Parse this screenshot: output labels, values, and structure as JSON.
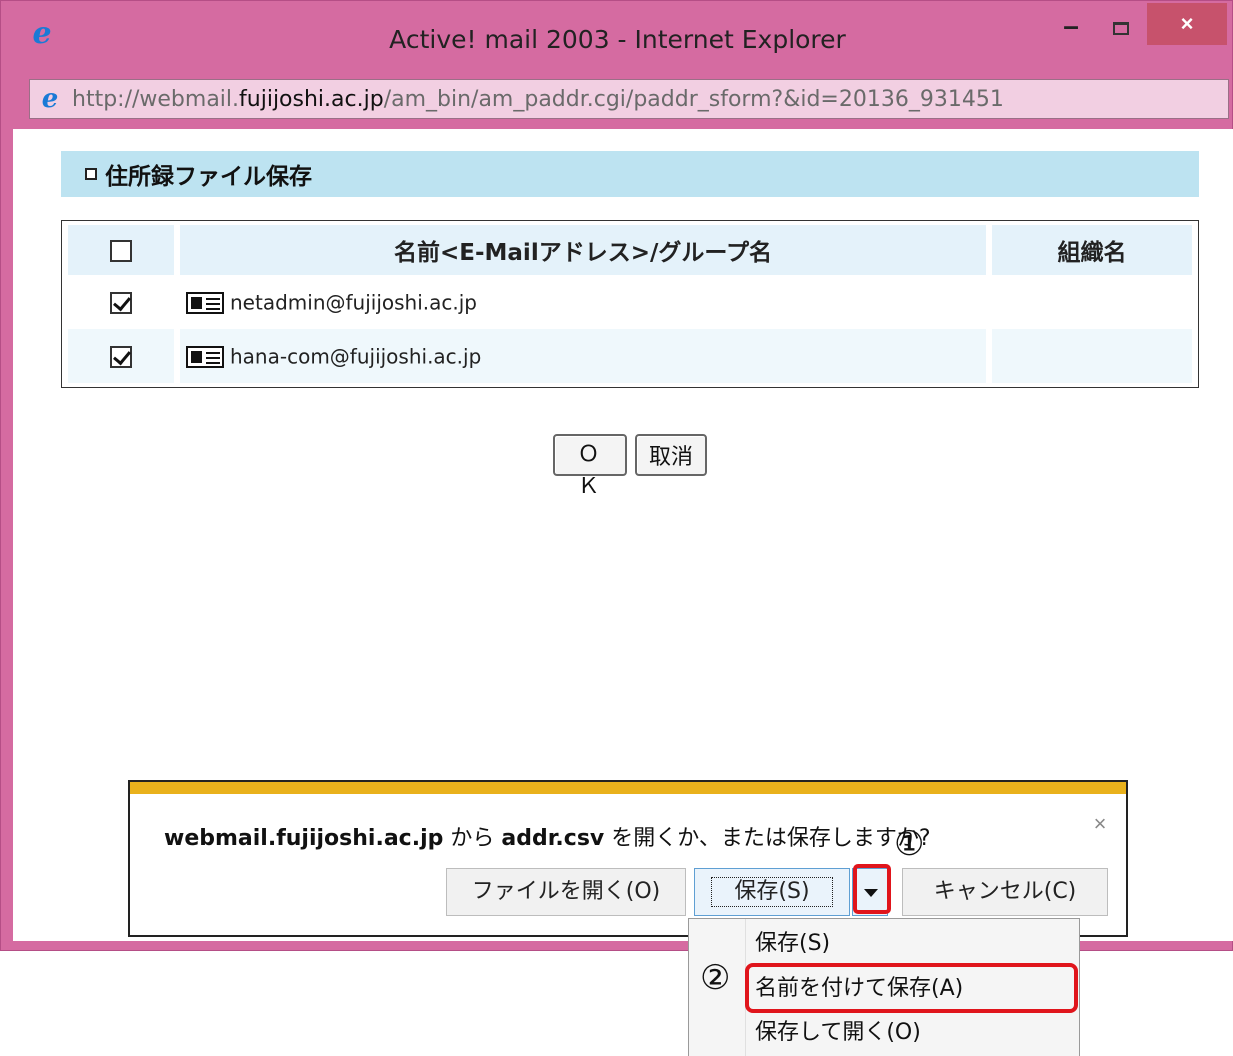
{
  "window": {
    "title": "Active! mail 2003 - Internet Explorer",
    "minimize": "–",
    "close": "×",
    "address": {
      "prefix": "http://webmail.",
      "host": "fujijoshi.ac.jp",
      "path": "/am_bin/am_paddr.cgi/paddr_sform?&id=20136_931451"
    }
  },
  "page": {
    "section_title": "住所録ファイル保存",
    "table": {
      "headers": {
        "name": "名前<E-Mailアドレス>/グループ名",
        "org": "組織名"
      },
      "rows": [
        {
          "checked": true,
          "email": "netadmin@fujijoshi.ac.jp",
          "org": ""
        },
        {
          "checked": true,
          "email": "hana-com@fujijoshi.ac.jp",
          "org": ""
        }
      ]
    },
    "ok_label": "ＯＫ",
    "cancel_label": "取消"
  },
  "download_bar": {
    "host": "webmail.fujijoshi.ac.jp",
    "from_text": " から ",
    "file": "addr.csv",
    "question": " を開くか、または保存しますか?",
    "close": "×",
    "open_label": "ファイルを開く(O)",
    "save_label": "保存(S)",
    "cancel_label": "キャンセル(C)"
  },
  "save_menu": {
    "items": [
      "保存(S)",
      "名前を付けて保存(A)",
      "保存して開く(O)"
    ]
  },
  "annotations": {
    "marker_1": "①",
    "marker_2": "②"
  },
  "colors": {
    "frame": "#d56ba1",
    "section_header": "#bde3f1",
    "notification_accent": "#e9b11c",
    "highlight": "#e0151c"
  }
}
